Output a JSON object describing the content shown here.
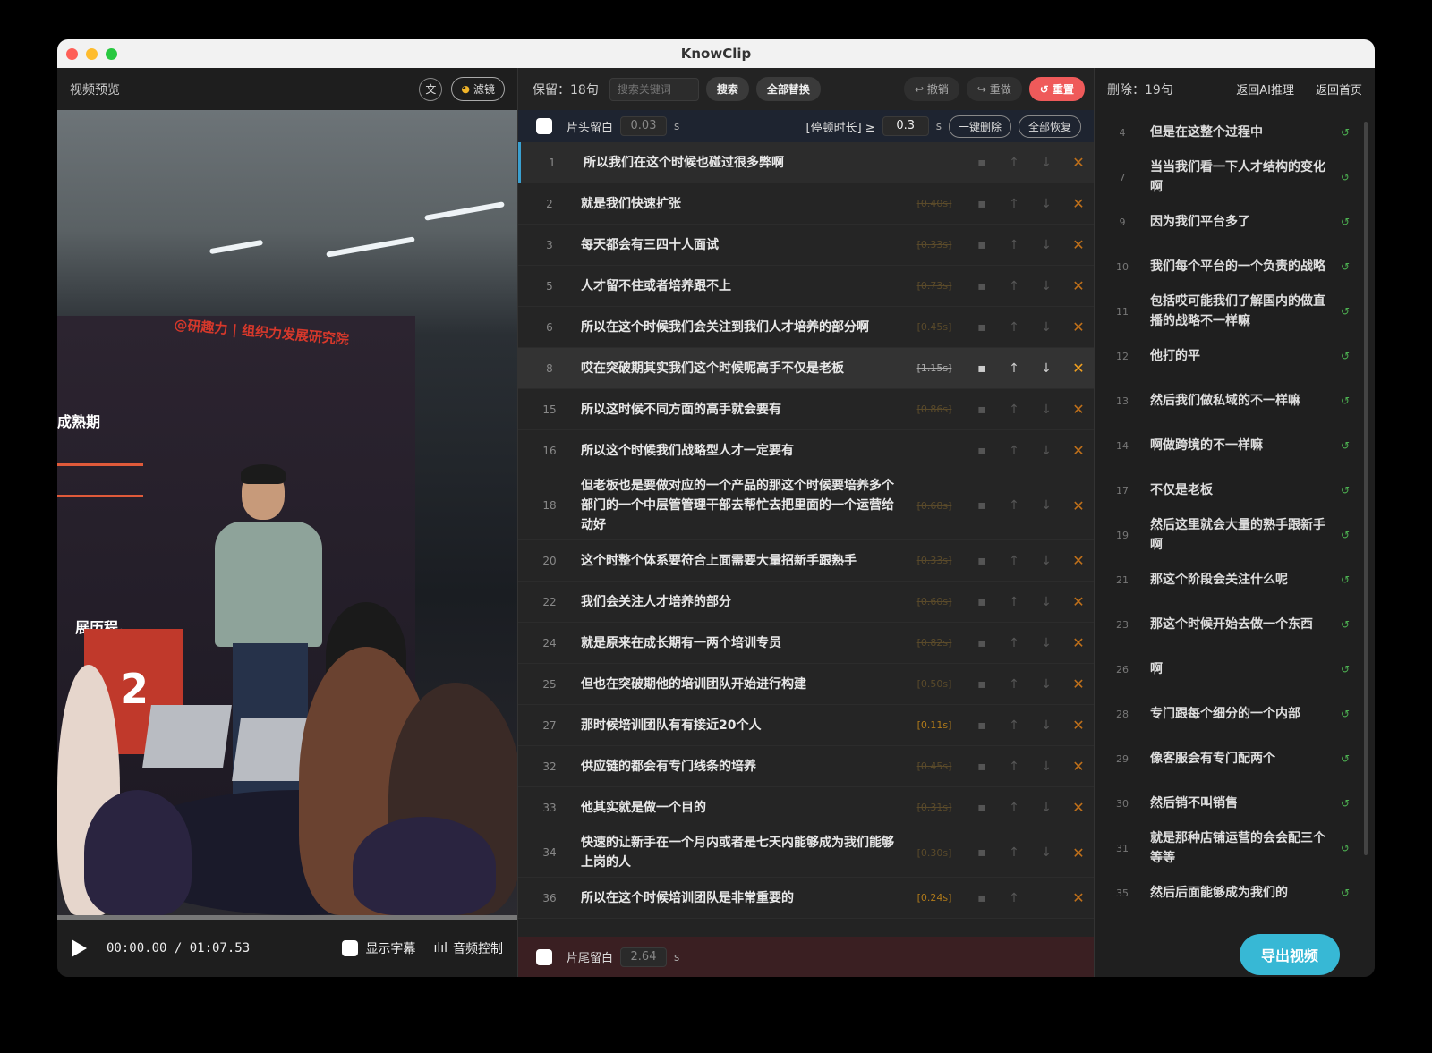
{
  "window": {
    "title": "KnowClip"
  },
  "left": {
    "title": "视频预览",
    "text_toggle": "文",
    "filter_label": "滤镜",
    "video_overlay": {
      "banner": "@研趣力 | 组织力发展研究院",
      "line1": "成熟期",
      "line2": "展历程。",
      "number": "2"
    },
    "time": "00:00.00 / 01:07.53",
    "show_subtitle": "显示字幕",
    "audio_control": "音频控制"
  },
  "mid": {
    "keep_label": "保留：18句",
    "search_placeholder": "搜索关键词",
    "search_btn": "搜索",
    "replace_all_btn": "全部替换",
    "undo_btn": "↩ 撤销",
    "redo_btn": "↪ 重做",
    "reset_btn": "↺ 重置",
    "head_blank_label": "片头留白",
    "head_blank_value": "0.03",
    "unit_s": "s",
    "pause_label": "[停顿时长] ≥",
    "pause_value": "0.3",
    "one_click_delete": "一键删除",
    "restore_all": "全部恢复",
    "tail_blank_label": "片尾留白",
    "tail_blank_value": "2.64",
    "rows": [
      {
        "idx": "1",
        "text": "所以我们在这个时候也碰过很多弊啊",
        "dur": ""
      },
      {
        "idx": "2",
        "text": "就是我们快速扩张",
        "dur": "[0.40s]"
      },
      {
        "idx": "3",
        "text": "每天都会有三四十人面试",
        "dur": "[0.33s]"
      },
      {
        "idx": "5",
        "text": "人才留不住或者培养跟不上",
        "dur": "[0.73s]"
      },
      {
        "idx": "6",
        "text": "所以在这个时候我们会关注到我们人才培养的部分啊",
        "dur": "[0.45s]"
      },
      {
        "idx": "8",
        "text": "哎在突破期其实我们这个时候呢高手不仅是老板",
        "dur": "[1.15s]"
      },
      {
        "idx": "15",
        "text": "所以这时候不同方面的高手就会要有",
        "dur": "[0.86s]"
      },
      {
        "idx": "16",
        "text": "所以这个时候我们战略型人才一定要有",
        "dur": ""
      },
      {
        "idx": "18",
        "text": "但老板也是要做对应的一个产品的那这个时候要培养多个部门的一个中层管管理干部去帮忙去把里面的一个运营给动好",
        "dur": "[0.68s]"
      },
      {
        "idx": "20",
        "text": "这个时整个体系要符合上面需要大量招新手跟熟手",
        "dur": "[0.33s]"
      },
      {
        "idx": "22",
        "text": "我们会关注人才培养的部分",
        "dur": "[0.60s]"
      },
      {
        "idx": "24",
        "text": "就是原来在成长期有一两个培训专员",
        "dur": "[0.82s]"
      },
      {
        "idx": "25",
        "text": "但也在突破期他的培训团队开始进行构建",
        "dur": "[0.50s]"
      },
      {
        "idx": "27",
        "text": "那时候培训团队有有接近20个人",
        "dur": "[0.11s]"
      },
      {
        "idx": "32",
        "text": "供应链的都会有专门线条的培养",
        "dur": "[0.45s]"
      },
      {
        "idx": "33",
        "text": "他其实就是做一个目的",
        "dur": "[0.31s]"
      },
      {
        "idx": "34",
        "text": "快速的让新手在一个月内或者是七天内能够成为我们能够上岗的人",
        "dur": "[0.30s]"
      },
      {
        "idx": "36",
        "text": "所以在这个时候培训团队是非常重要的",
        "dur": "[0.24s]"
      }
    ]
  },
  "right": {
    "deleted_label": "删除：19句",
    "back_ai": "返回AI推理",
    "back_home": "返回首页",
    "export_btn": "导出视频",
    "rows": [
      {
        "idx": "4",
        "text": "但是在这整个过程中"
      },
      {
        "idx": "7",
        "text": "当当我们看一下人才结构的变化啊"
      },
      {
        "idx": "9",
        "text": "因为我们平台多了"
      },
      {
        "idx": "10",
        "text": "我们每个平台的一个负责的战略"
      },
      {
        "idx": "11",
        "text": "包括哎可能我们了解国内的做直播的战略不一样嘛"
      },
      {
        "idx": "12",
        "text": "他打的平"
      },
      {
        "idx": "13",
        "text": "然后我们做私域的不一样嘛"
      },
      {
        "idx": "14",
        "text": "啊做跨境的不一样嘛"
      },
      {
        "idx": "17",
        "text": "不仅是老板"
      },
      {
        "idx": "19",
        "text": "然后这里就会大量的熟手跟新手啊"
      },
      {
        "idx": "21",
        "text": "那这个阶段会关注什么呢"
      },
      {
        "idx": "23",
        "text": "那这个时候开始去做一个东西"
      },
      {
        "idx": "26",
        "text": "啊"
      },
      {
        "idx": "28",
        "text": "专门跟每个细分的一个内部"
      },
      {
        "idx": "29",
        "text": "像客服会有专门配两个"
      },
      {
        "idx": "30",
        "text": "然后销不叫销售"
      },
      {
        "idx": "31",
        "text": "就是那种店铺运营的会会配三个等等"
      },
      {
        "idx": "35",
        "text": "然后后面能够成为我们的"
      }
    ]
  }
}
